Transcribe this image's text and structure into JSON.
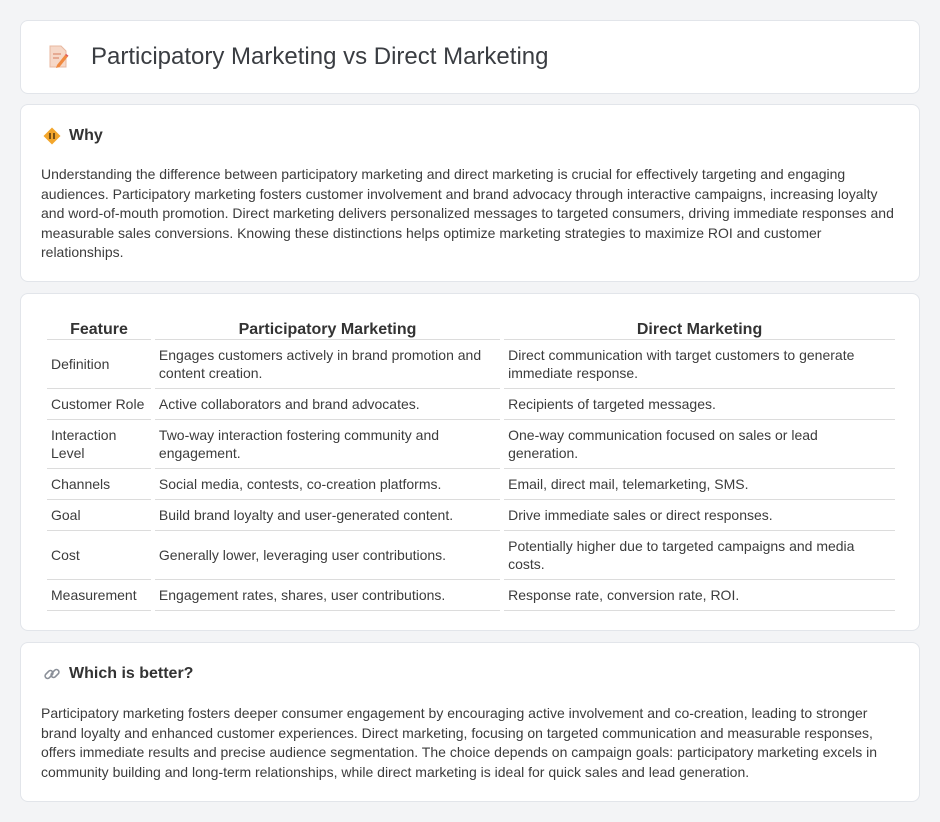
{
  "header": {
    "title": "Participatory Marketing vs Direct Marketing",
    "icon": "document-edit-icon"
  },
  "why": {
    "icon": "diamond-signal-icon",
    "title": "Why",
    "text": "Understanding the difference between participatory marketing and direct marketing is crucial for effectively targeting and engaging audiences. Participatory marketing fosters customer involvement and brand advocacy through interactive campaigns, increasing loyalty and word-of-mouth promotion. Direct marketing delivers personalized messages to targeted consumers, driving immediate responses and measurable sales conversions. Knowing these distinctions helps optimize marketing strategies to maximize ROI and customer relationships."
  },
  "table": {
    "headers": [
      "Feature",
      "Participatory Marketing",
      "Direct Marketing"
    ],
    "rows": [
      [
        "Definition",
        "Engages customers actively in brand promotion and content creation.",
        "Direct communication with target customers to generate immediate response."
      ],
      [
        "Customer Role",
        "Active collaborators and brand advocates.",
        "Recipients of targeted messages."
      ],
      [
        "Interaction Level",
        "Two-way interaction fostering community and engagement.",
        "One-way communication focused on sales or lead generation."
      ],
      [
        "Channels",
        "Social media, contests, co-creation platforms.",
        "Email, direct mail, telemarketing, SMS."
      ],
      [
        "Goal",
        "Build brand loyalty and user-generated content.",
        "Drive immediate sales or direct responses."
      ],
      [
        "Cost",
        "Generally lower, leveraging user contributions.",
        "Potentially higher due to targeted campaigns and media costs."
      ],
      [
        "Measurement",
        "Engagement rates, shares, user contributions.",
        "Response rate, conversion rate, ROI."
      ]
    ]
  },
  "better": {
    "icon": "link-icon",
    "title": "Which is better?",
    "text": "Participatory marketing fosters deeper consumer engagement by encouraging active involvement and co-creation, leading to stronger brand loyalty and enhanced customer experiences. Direct marketing, focusing on targeted communication and measurable responses, offers immediate results and precise audience segmentation. The choice depends on campaign goals: participatory marketing excels in community building and long-term relationships, while direct marketing is ideal for quick sales and lead generation."
  },
  "colors": {
    "accent": "#f0a030",
    "background": "#f3f4f6",
    "card": "#ffffff"
  }
}
